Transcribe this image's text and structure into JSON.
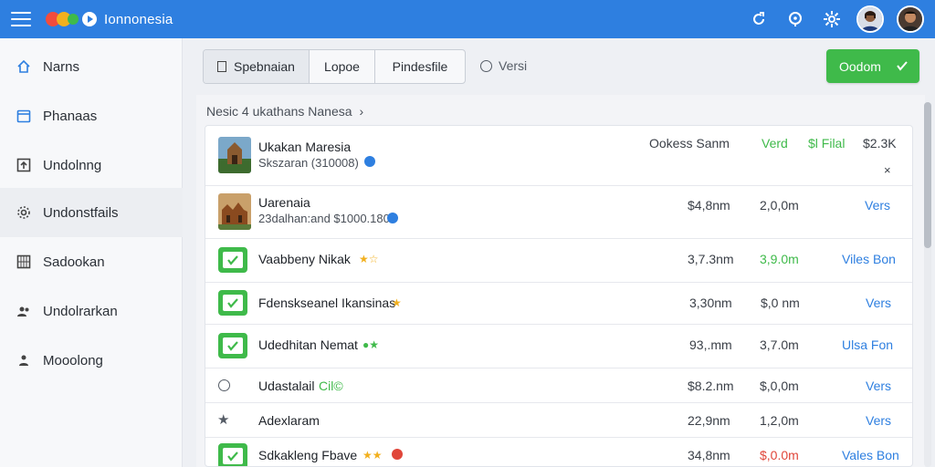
{
  "app": {
    "brand": "Ionnonesia"
  },
  "sidebar": {
    "items": [
      {
        "label": "Narns"
      },
      {
        "label": "Phanaas"
      },
      {
        "label": "Undolnng"
      },
      {
        "label": "Undonstfails"
      },
      {
        "label": "Sadookan"
      },
      {
        "label": "Undolrarkan"
      },
      {
        "label": "Mooolong"
      }
    ]
  },
  "toolbar": {
    "tabs": [
      "Spebnaian",
      "Lopoe",
      "Pindesfile"
    ],
    "versi_label": "Versi",
    "primary_button": "Oodom"
  },
  "breadcrumb": {
    "text": "Nesic 4 ukathans Nanesa",
    "sep": "›"
  },
  "header_row": {
    "title": "Ukakan Maresia",
    "subtitle": "Skszaran (310008)",
    "col1": "Ookess Sanm",
    "col2": "Verd",
    "col3": "$l Filal",
    "col4": "$2.3K",
    "close": "×"
  },
  "rows": [
    {
      "title": "Uarenaia",
      "subtitle": "23dalhan:and $1000.180",
      "col1": "$4,8nm",
      "col2": "2,0,0m",
      "col3": "Vers"
    },
    {
      "title": "Vaabbeny Nikak",
      "stars": "★☆",
      "col1": "3,7.3nm",
      "col2": "3,9.0m",
      "col3": "Viles Bon"
    },
    {
      "title": "Fdenskseanel Ikansinas",
      "stars": "★",
      "col1": "3,30nm",
      "col2": "$,0 nm",
      "col3": "Vers"
    },
    {
      "title": "Udedhitan Nemat",
      "stars": "●★",
      "col1": "93,.mm",
      "col2": "3,7.0m",
      "col3": "Ulsa Fon"
    },
    {
      "title": "Udastalail",
      "title_extra": "Cil©",
      "col1": "$8.2.nm",
      "col2": "$,0,0m",
      "col3": "Vers"
    },
    {
      "title": "Adexlaram",
      "col1": "22,9nm",
      "col2": "1,2,0m",
      "col3": "Vers"
    },
    {
      "title": "Sdkakleng Fbave",
      "stars": "★★",
      "col1": "34,8nm",
      "col2": "$,0.0m",
      "col3": "Vales Bon"
    }
  ],
  "colors": {
    "accent": "#2e7fe0",
    "success": "#3fba4a",
    "danger": "#e0463a"
  }
}
